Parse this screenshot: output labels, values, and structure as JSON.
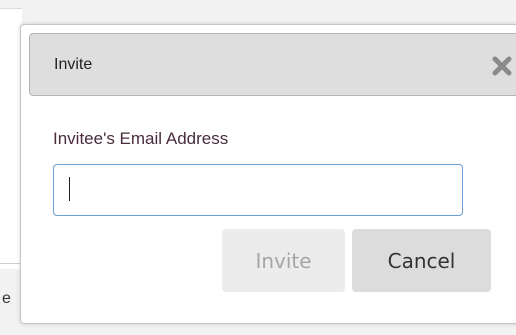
{
  "dialog": {
    "title": "Invite",
    "close_icon": "close-x-icon",
    "email_label": "Invitee's Email Address",
    "email_value": "",
    "email_placeholder": "",
    "invite_label": "Invite",
    "cancel_label": "Cancel"
  },
  "background": {
    "edge_text": "e"
  },
  "colors": {
    "titlebar": "#dedede",
    "input_focus_border": "#6a9fd4",
    "invite_disabled_text": "#a6a6a6",
    "cancel_bg": "#dcdcdc"
  }
}
